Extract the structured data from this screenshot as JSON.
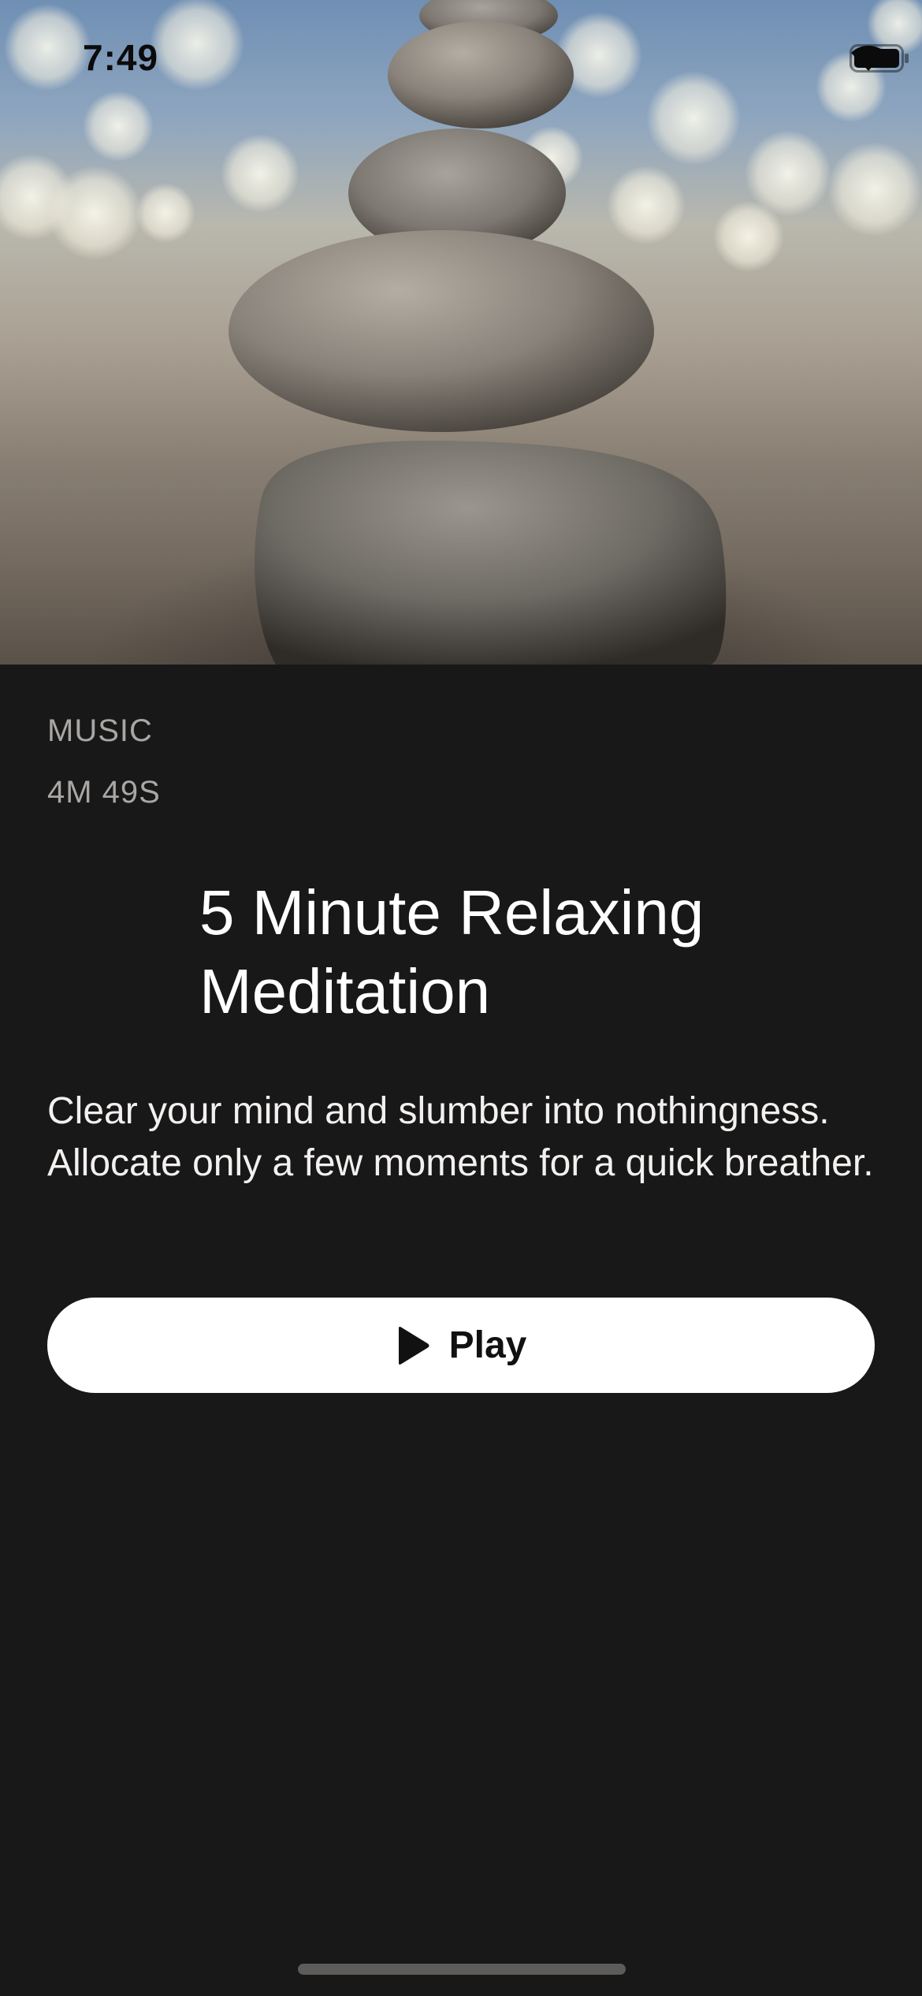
{
  "status_bar": {
    "time": "7:49"
  },
  "hero": {
    "image_subject": "stacked-stones-photo"
  },
  "track": {
    "category": "MUSIC",
    "duration": "4M 49S",
    "title": "5 Minute Relaxing Meditation",
    "description": "Clear your mind and slumber into nothingness. Allocate only a few moments for a quick breather."
  },
  "actions": {
    "play_label": "Play",
    "play_icon": "play-icon"
  },
  "colors": {
    "background": "#191818",
    "button_background": "#ffffff",
    "text_primary": "#ffffff",
    "text_secondary": "#a9a7a4"
  }
}
